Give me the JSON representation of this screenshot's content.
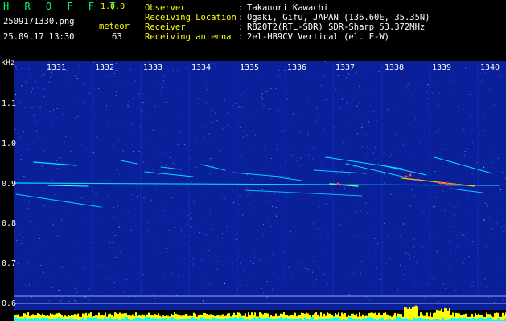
{
  "header": {
    "app_name": "H R O F F T",
    "version": "1.0.0",
    "filename": "2509171330.png",
    "datetime": "25.09.17 13:30",
    "meteor_label": "meteor",
    "meteor_count": "63",
    "fields": [
      {
        "label": "Observer",
        "sep": ":",
        "value": "Takanori Kawachi"
      },
      {
        "label": "Receiving Location",
        "sep": ":",
        "value": "Ogaki, Gifu, JAPAN (136.60E, 35.35N)"
      },
      {
        "label": "Receiver",
        "sep": ":",
        "value": "R820T2(RTL-SDR) SDR-Sharp 53.372MHz"
      },
      {
        "label": "Receiving antenna",
        "sep": ":",
        "value": "2el-HB9CV Vertical (el. E-W)"
      }
    ]
  },
  "axis": {
    "y_unit": "kHz",
    "y_ticks": [
      "1.1",
      "1.0",
      "0.9",
      "0.8",
      "0.7",
      "0.6"
    ],
    "x_ticks": [
      "1331",
      "1332",
      "1333",
      "1334",
      "1335",
      "1336",
      "1337",
      "1338",
      "1339",
      "1340"
    ]
  },
  "colors": {
    "background": "#000000",
    "spectrogram": "#0a1a8a",
    "brand": "#00ff66",
    "accent": "#ffff00",
    "signal": "#00ffff"
  }
}
